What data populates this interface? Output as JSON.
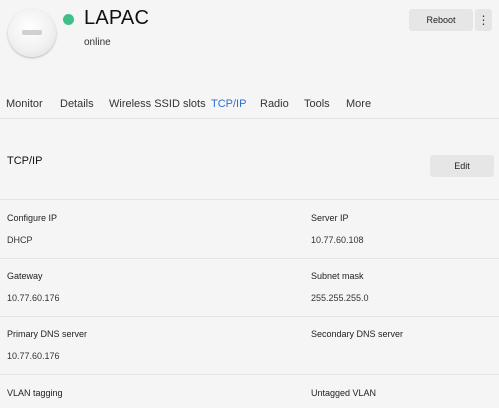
{
  "device": {
    "name": "LAPAC",
    "status": "online",
    "status_color": "#3fbf8a",
    "image": "access-point-image"
  },
  "header": {
    "reboot_label": "Reboot",
    "more_icon": "⋮"
  },
  "tabs": [
    {
      "label": "Monitor"
    },
    {
      "label": "Details"
    },
    {
      "label": "Wireless SSID slots"
    },
    {
      "label": "TCP/IP",
      "active": true
    },
    {
      "label": "Radio"
    },
    {
      "label": "Tools"
    },
    {
      "label": "More"
    }
  ],
  "accent_color": "#2c6fd1",
  "section": {
    "title": "TCP/IP",
    "edit_label": "Edit"
  },
  "fields": [
    {
      "label": "Configure IP",
      "value": "DHCP"
    },
    {
      "label": "Server IP",
      "value": "10.77.60.108"
    },
    {
      "label": "Gateway",
      "value": "10.77.60.176"
    },
    {
      "label": "Subnet mask",
      "value": "255.255.255.0"
    },
    {
      "label": "Primary DNS server",
      "value": "10.77.60.176"
    },
    {
      "label": "Secondary DNS server",
      "value": ""
    },
    {
      "label": "VLAN tagging",
      "value": ""
    },
    {
      "label": "Untagged VLAN",
      "value": ""
    }
  ]
}
